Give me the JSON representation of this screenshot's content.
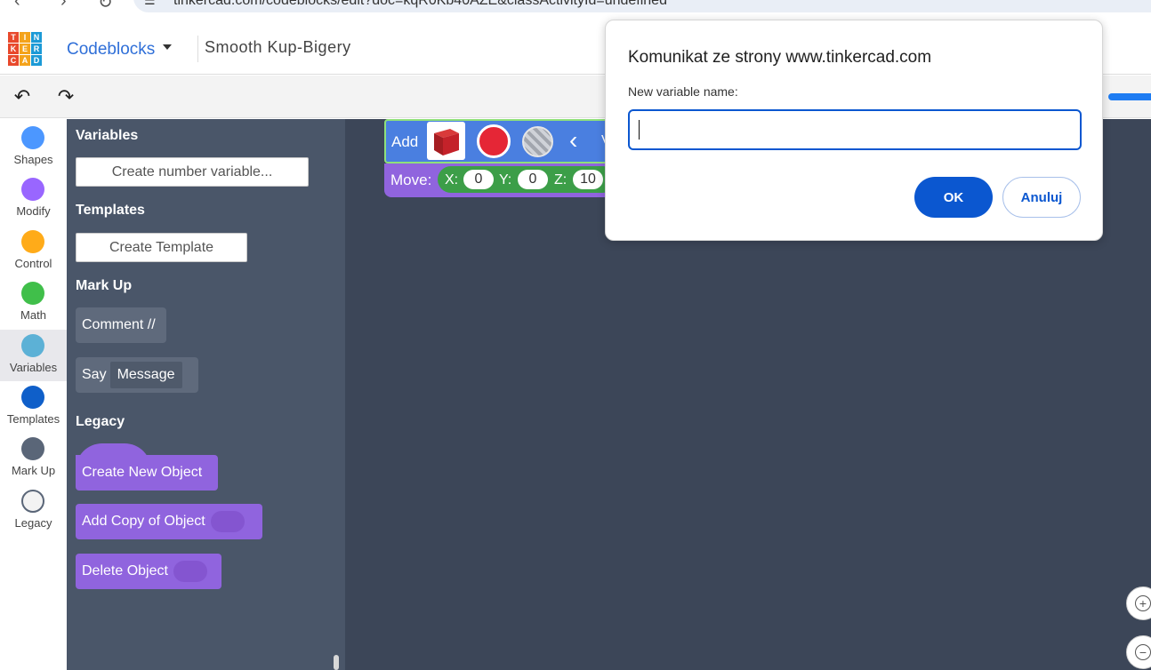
{
  "browser": {
    "url": "tinkercad.com/codeblocks/edit?doc=kqR0Kb40AZE&classActivityId=undefined"
  },
  "header": {
    "logo_letters": [
      "T",
      "I",
      "N",
      "K",
      "E",
      "R",
      "C",
      "A",
      "D"
    ],
    "logo_colors": [
      "#e8492c",
      "#f4a31b",
      "#1c9ad6",
      "#e8492c",
      "#f4a31b",
      "#1c9ad6",
      "#e8492c",
      "#f4a31b",
      "#1c9ad6"
    ],
    "app_name": "Codeblocks",
    "project_title": "Smooth Kup-Bigery"
  },
  "toolbar": {
    "undo_icon": "undo-arrow",
    "redo_icon": "redo-arrow"
  },
  "categories": [
    {
      "label": "Shapes",
      "color": "#4c97ff"
    },
    {
      "label": "Modify",
      "color": "#9966ff"
    },
    {
      "label": "Control",
      "color": "#ffab19"
    },
    {
      "label": "Math",
      "color": "#40bf4a"
    },
    {
      "label": "Variables",
      "color": "#5cb1d6",
      "active": true
    },
    {
      "label": "Templates",
      "color": "#0f5fc9"
    },
    {
      "label": "Mark Up",
      "color": "#5a6678"
    },
    {
      "label": "Legacy",
      "color": "#f3f3f3"
    }
  ],
  "flyout": {
    "variables_heading": "Variables",
    "create_number_variable": "Create number variable...",
    "templates_heading": "Templates",
    "create_template": "Create Template",
    "markup_heading": "Mark Up",
    "comment_block": "Comment //",
    "say_block": "Say",
    "say_message": "Message",
    "legacy_heading": "Legacy",
    "create_new_object": "Create New Object",
    "add_copy_of_object": "Add Copy of Object",
    "delete_object": "Delete Object"
  },
  "workspace": {
    "add_label": "Add",
    "add_trailing": "V",
    "move_label": "Move:",
    "x_label": "X:",
    "x_value": "0",
    "y_label": "Y:",
    "y_value": "0",
    "z_label": "Z:",
    "z_value": "10"
  },
  "dialog": {
    "title": "Komunikat ze strony www.tinkercad.com",
    "prompt": "New variable name:",
    "input_value": "",
    "ok_label": "OK",
    "cancel_label": "Anuluj"
  }
}
